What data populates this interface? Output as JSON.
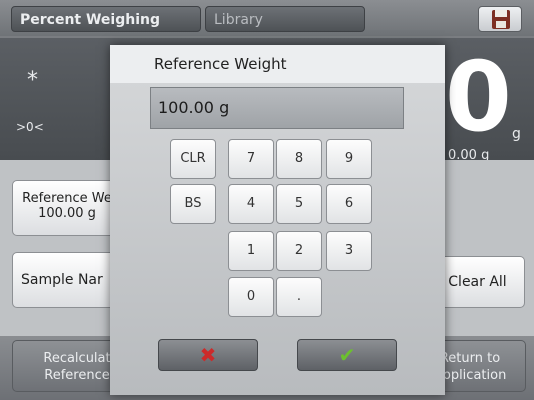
{
  "header": {
    "app_tab": "Percent Weighing",
    "library_tab": "Library",
    "save_icon": "floppy-disk-icon"
  },
  "readout": {
    "stable_indicator": "*",
    "zero_indicator": ">0<",
    "main_digit": "0",
    "unit": "g",
    "sub_value": "0.00 g"
  },
  "panel": {
    "reference_label": "Reference We",
    "reference_value": "100.00 g",
    "sample_label": "Sample Nar",
    "clear_all_label": "Clear All"
  },
  "footer": {
    "recalc_line1": "Recalculat",
    "recalc_line2": "Reference",
    "return_line1": "Return to",
    "return_line2": "Application"
  },
  "dialog": {
    "title": "Reference Weight",
    "value": "100.00 g",
    "keys": {
      "clr": "CLR",
      "bs": "BS",
      "k7": "7",
      "k8": "8",
      "k9": "9",
      "k4": "4",
      "k5": "5",
      "k6": "6",
      "k1": "1",
      "k2": "2",
      "k3": "3",
      "k0": "0",
      "dot": "."
    },
    "cancel_symbol": "✖",
    "ok_symbol": "✔"
  },
  "colors": {
    "cancel": "#cc2a2a",
    "ok": "#6cc12e"
  }
}
